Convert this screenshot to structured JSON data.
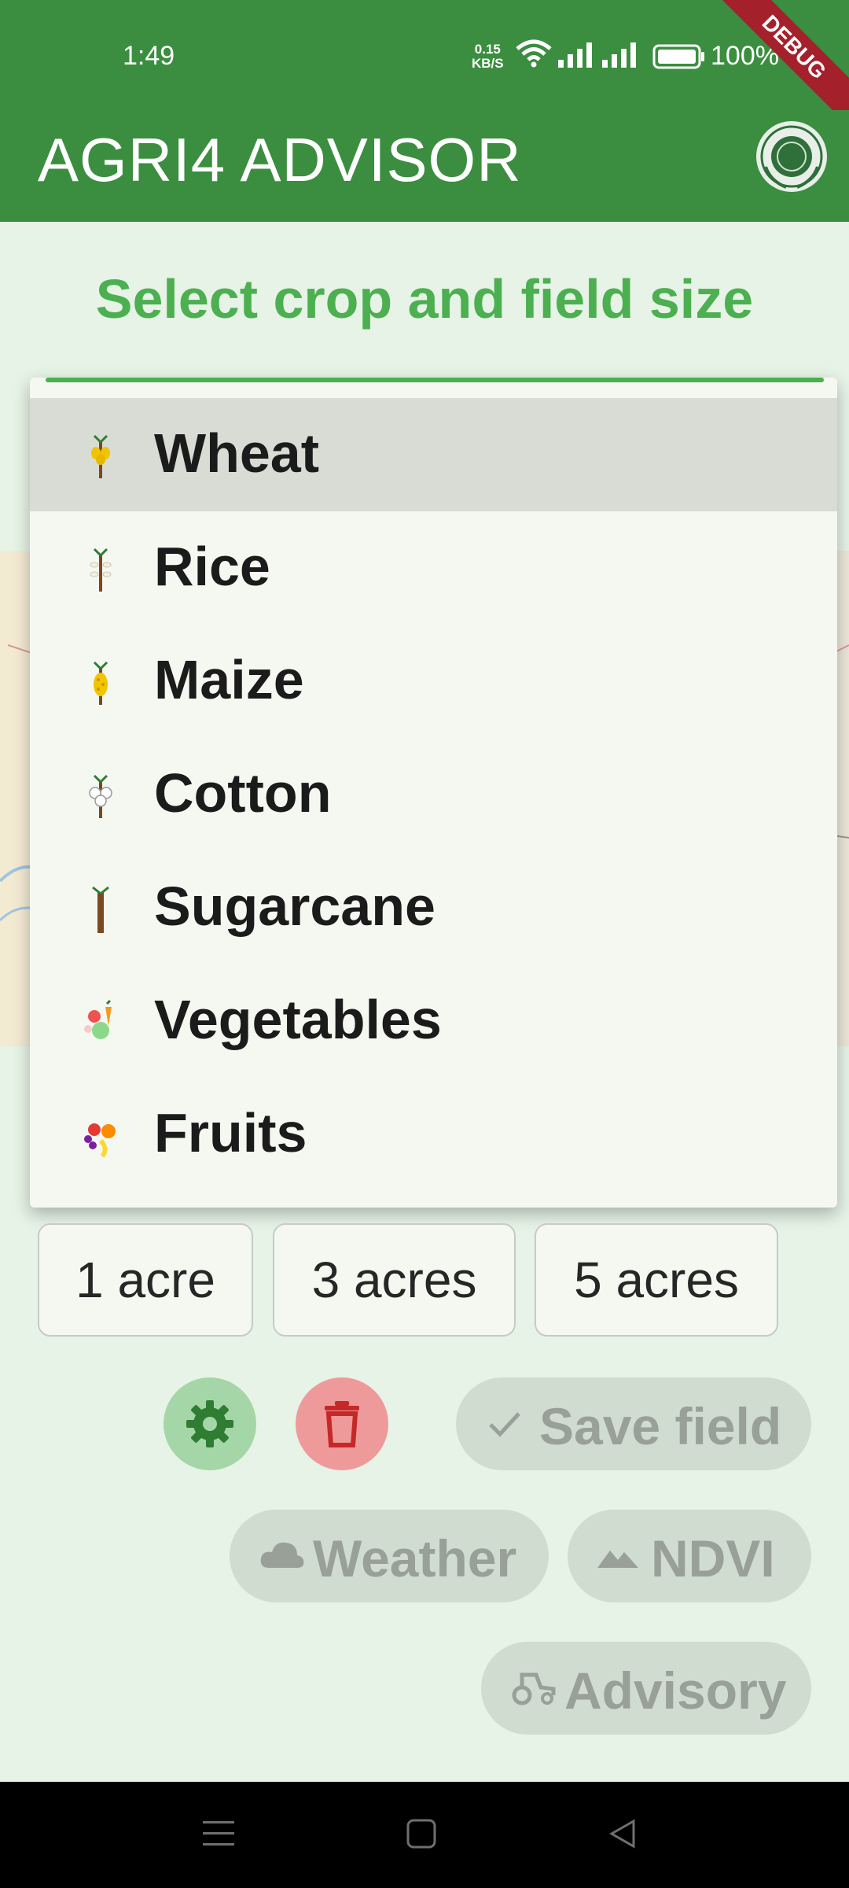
{
  "status_bar": {
    "time": "1:49",
    "net_speed_value": "0.15",
    "net_speed_unit": "KB/S",
    "battery": "100%",
    "debug_banner": "DEBUG"
  },
  "app_bar": {
    "title": "AGRI4 ADVISOR"
  },
  "subtitle": "Select crop and field size",
  "dropdown": {
    "items": [
      {
        "label": "Wheat",
        "icon": "wheat-icon",
        "selected": true
      },
      {
        "label": "Rice",
        "icon": "rice-icon"
      },
      {
        "label": "Maize",
        "icon": "maize-icon"
      },
      {
        "label": "Cotton",
        "icon": "cotton-icon"
      },
      {
        "label": "Sugarcane",
        "icon": "sugarcane-icon"
      },
      {
        "label": "Vegetables",
        "icon": "vegetables-icon"
      },
      {
        "label": "Fruits",
        "icon": "fruits-icon"
      }
    ]
  },
  "field_sizes": [
    "1 acre",
    "3 acres",
    "5 acres"
  ],
  "actions": {
    "save_field": "Save field",
    "weather": "Weather",
    "ndvi": "NDVI",
    "advisory": "Advisory"
  },
  "colors": {
    "primary": "#3b8e3f",
    "accent_text": "#4caf50",
    "background": "#e6f3e6",
    "delete": "#ef9a9a"
  }
}
